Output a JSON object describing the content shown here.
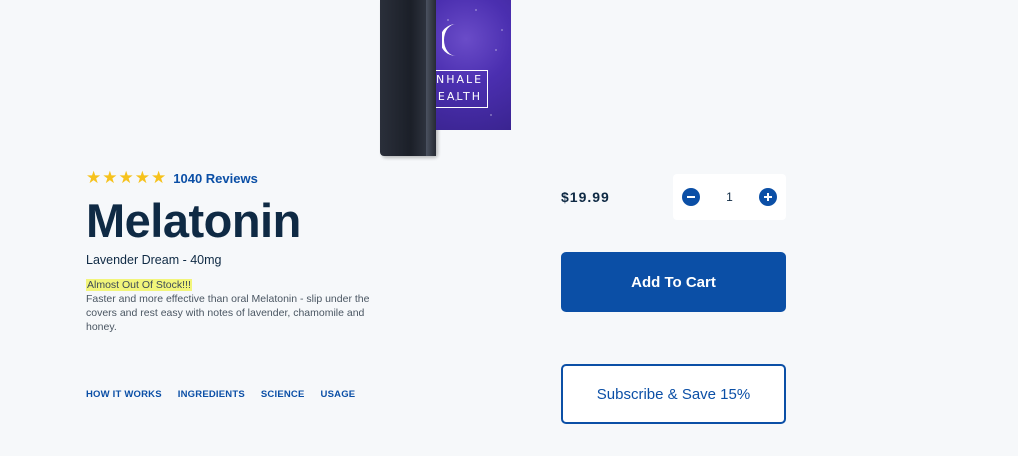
{
  "product_image": {
    "brand_line1": "NHALE",
    "brand_line2": "EALTH",
    "icon": "crescent-moon-icon",
    "colors": {
      "box": "#4b2fb0",
      "device": "#1b1f28"
    }
  },
  "rating": {
    "stars": 5,
    "max_stars": 5,
    "star_glyph": "★",
    "reviews_text": "1040 Reviews"
  },
  "product": {
    "title": "Melatonin",
    "variant": "Lavender Dream - 40mg",
    "stock_notice": "Almost Out Of Stock!!!",
    "description": "Faster and more effective than oral Melatonin - slip under the covers and rest easy with notes of lavender, chamomile and honey."
  },
  "tabs": [
    {
      "label": "HOW IT WORKS"
    },
    {
      "label": "INGREDIENTS"
    },
    {
      "label": "SCIENCE"
    },
    {
      "label": "USAGE"
    }
  ],
  "purchase": {
    "price": "$19.99",
    "quantity": "1",
    "add_to_cart_label": "Add To Cart",
    "subscribe_label": "Subscribe & Save 15%"
  },
  "colors": {
    "primary": "#0b4fa6",
    "heading": "#0f2a44",
    "star": "#f6c21c",
    "highlight": "#f2f57a",
    "background": "#f6f8fa"
  }
}
